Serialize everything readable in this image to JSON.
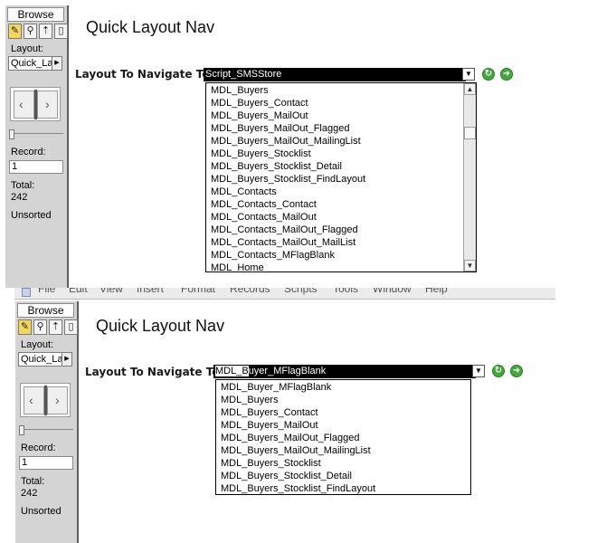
{
  "top": {
    "status_area": {
      "mode": "Browse",
      "layout_label": "Layout:",
      "layout_value": "Quick_La",
      "record_label": "Record:",
      "record_value": "1",
      "total_label": "Total:",
      "total_value": "242",
      "sort_status": "Unsorted"
    },
    "title": "Quick Layout Nav",
    "nav_label": "Layout To Navigate To",
    "dropdown_value": "Script_SMSStore",
    "list_items": [
      "MDL_Buyers",
      "MDL_Buyers_Contact",
      "MDL_Buyers_MailOut",
      "MDL_Buyers_MailOut_Flagged",
      "MDL_Buyers_MailOut_MailingList",
      "MDL_Buyers_Stocklist",
      "MDL_Buyers_Stocklist_Detail",
      "MDL_Buyers_Stocklist_FindLayout",
      "MDL_Contacts",
      "MDL_Contacts_Contact",
      "MDL_Contacts_MailOut",
      "MDL_Contacts_MailOut_Flagged",
      "MDL_Contacts_MailOut_MailList",
      "MDL_Contacts_MFlagBlank",
      "MDL_Home"
    ]
  },
  "bottom": {
    "menubar": [
      "File",
      "Edit",
      "View",
      "Insert",
      "Format",
      "Records",
      "Scripts",
      "Tools",
      "Window",
      "Help"
    ],
    "status_area": {
      "mode": "Browse",
      "layout_label": "Layout:",
      "layout_value": "Quick_La",
      "record_label": "Record:",
      "record_value": "1",
      "total_label": "Total:",
      "total_value": "242",
      "sort_status": "Unsorted"
    },
    "title": "Quick Layout Nav",
    "nav_label": "Layout To Navigate To",
    "dropdown_typed": "MDL_B",
    "dropdown_rest": "uyer_MFlagBlank",
    "list_items": [
      "MDL_Buyer_MFlagBlank",
      "MDL_Buyers",
      "MDL_Buyers_Contact",
      "MDL_Buyers_MailOut",
      "MDL_Buyers_MailOut_Flagged",
      "MDL_Buyers_MailOut_MailingList",
      "MDL_Buyers_Stocklist",
      "MDL_Buyers_Stocklist_Detail",
      "MDL_Buyers_Stocklist_FindLayout"
    ]
  },
  "icons": {
    "tools": [
      "pencil-icon",
      "magnifier-icon",
      "pointer-icon",
      "page-icon"
    ],
    "refresh": "refresh-icon",
    "go": "go-arrow-icon",
    "book": "book-icon"
  },
  "colors": {
    "status_bg": "#d4d4d4",
    "go_button": "#43a83c",
    "dropdown_bg": "#000000",
    "active_tool": "#f3d65a"
  }
}
